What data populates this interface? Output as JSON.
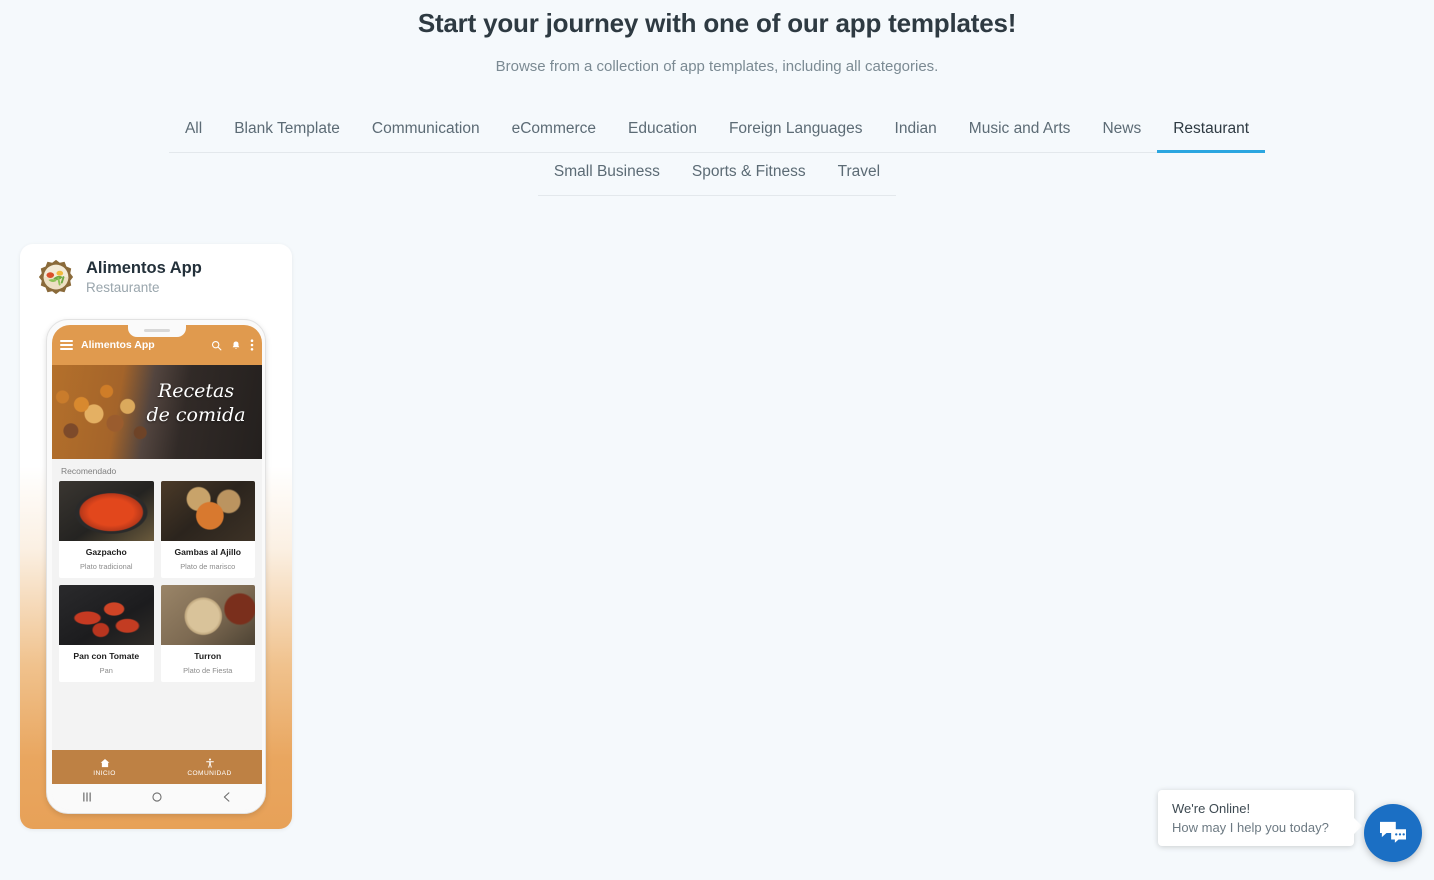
{
  "header": {
    "title": "Start your journey with one of our app templates!",
    "subtitle": "Browse from a collection of app templates, including all categories."
  },
  "tabs": {
    "row1": [
      {
        "label": "All",
        "active": false
      },
      {
        "label": "Blank Template",
        "active": false
      },
      {
        "label": "Communication",
        "active": false
      },
      {
        "label": "eCommerce",
        "active": false
      },
      {
        "label": "Education",
        "active": false
      },
      {
        "label": "Foreign Languages",
        "active": false
      },
      {
        "label": "Indian",
        "active": false
      },
      {
        "label": "Music and Arts",
        "active": false
      },
      {
        "label": "News",
        "active": false
      },
      {
        "label": "Restaurant",
        "active": true
      }
    ],
    "row2": [
      {
        "label": "Small Business",
        "active": false
      },
      {
        "label": "Sports & Fitness",
        "active": false
      },
      {
        "label": "Travel",
        "active": false
      }
    ],
    "active_color": "#2ba6e0"
  },
  "template_card": {
    "app_name": "Alimentos App",
    "category": "Restaurante",
    "icon": "salad-bowl-icon",
    "accent_color": "#e09a4e",
    "nav_color": "#be8144",
    "phone": {
      "appbar": {
        "title": "Alimentos App",
        "menu_icon": "hamburger-icon",
        "search_icon": "search-icon",
        "bell_icon": "bell-icon",
        "overflow_icon": "kebab-menu-icon"
      },
      "hero": {
        "line1": "Recetas",
        "line2": "de comida"
      },
      "section_label": "Recomendado",
      "dishes": [
        {
          "name": "Gazpacho",
          "subtitle": "Plato tradicional",
          "img": "img-gazpacho"
        },
        {
          "name": "Gambas al Ajillo",
          "subtitle": "Plato de marisco",
          "img": "img-gambas"
        },
        {
          "name": "Pan con Tomate",
          "subtitle": "Pan",
          "img": "img-pan"
        },
        {
          "name": "Turron",
          "subtitle": "Plato de Fiesta",
          "img": "img-turron"
        }
      ],
      "bottom_nav": [
        {
          "label": "INICIO",
          "icon": "home-icon"
        },
        {
          "label": "COMUNIDAD",
          "icon": "accessibility-icon"
        }
      ],
      "system_nav": [
        {
          "icon": "recent-apps-icon"
        },
        {
          "icon": "home-circle-icon"
        },
        {
          "icon": "back-icon"
        }
      ]
    }
  },
  "chat_widget": {
    "line1": "We're Online!",
    "line2": "How may I help you today?",
    "fab_icon": "chat-bubbles-icon",
    "fab_color": "#1b6fc4"
  }
}
